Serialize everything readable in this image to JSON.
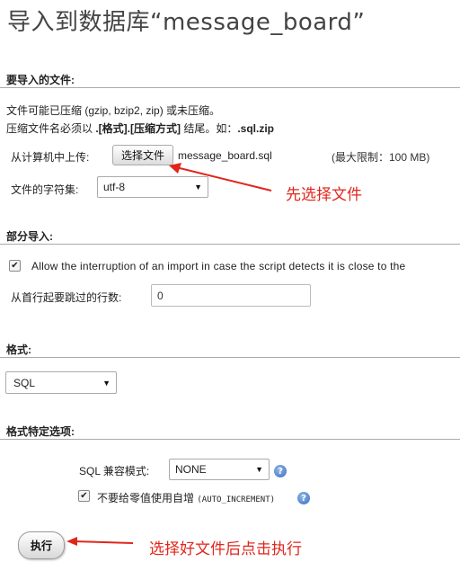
{
  "page": {
    "title": "导入到数据库“message_board”"
  },
  "file_section": {
    "heading": "要导入的文件:",
    "line1": "文件可能已压缩 (gzip, bzip2, zip) 或未压缩。",
    "line2_prefix": "压缩文件名必须以 ",
    "line2_bold": ".[格式].[压缩方式]",
    "line2_mid": " 结尾。如：",
    "line2_example": ".sql.zip",
    "upload_label": "从计算机中上传:",
    "choose_file_button": "选择文件",
    "chosen_file": "message_board.sql",
    "max_limit": "(最大限制：100 MB)",
    "charset_label": "文件的字符集:",
    "charset_value": "utf-8"
  },
  "partial_section": {
    "heading": "部分导入:",
    "allow_interrupt_checked": true,
    "allow_interrupt_label": "Allow the interruption of an import in case the script detects it is close to the",
    "skip_rows_label": "从首行起要跳过的行数:",
    "skip_rows_value": "0"
  },
  "format_section": {
    "heading": "格式:",
    "format_value": "SQL"
  },
  "format_options_section": {
    "heading": "格式特定选项:",
    "sql_compat_label": "SQL 兼容模式:",
    "sql_compat_value": "NONE",
    "no_auto_value_checked": true,
    "no_auto_value_label": "不要给零值使用自增",
    "no_auto_value_code": "(AUTO_INCREMENT)"
  },
  "actions": {
    "execute_button": "执行"
  },
  "annotations": {
    "choose_file_note": "先选择文件",
    "execute_note": "选择好文件后点击执行",
    "color": "#e0261c"
  },
  "icons": {
    "help": "help-icon",
    "dropdown": "chevron-down-icon",
    "checkbox": "checkmark-icon",
    "annotation_arrow": "red-arrow-icon"
  }
}
